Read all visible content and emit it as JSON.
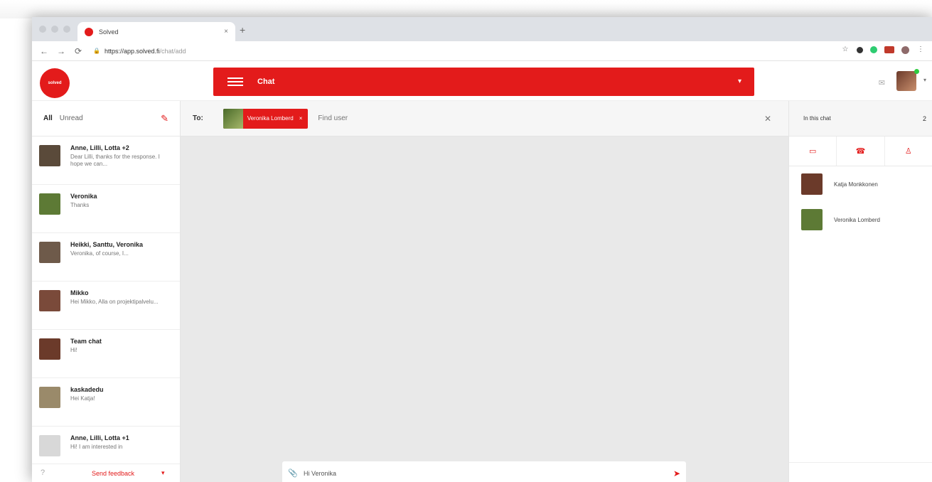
{
  "browser": {
    "tab_title": "Solved",
    "tab_close": "×",
    "new_tab": "+",
    "url_main": "https://app.solved.fi",
    "url_path": "/chat/add",
    "back": "←",
    "forward": "→",
    "reload": "⟳"
  },
  "header": {
    "logo_text": "solved",
    "section_title": "Chat",
    "section_caret": "▾",
    "user_caret": "▾"
  },
  "sidebar": {
    "filter_all": "All",
    "filter_unread": "Unread",
    "conversations": [
      {
        "name": "Anne, Lilli, Lotta +2",
        "message": "Dear Lilli, thanks for the response. I hope we can...",
        "avatar_color": "#5a4a3a"
      },
      {
        "name": "Veronika",
        "message": "Thanks",
        "avatar_color": "#5d7a35"
      },
      {
        "name": "Heikki, Santtu, Veronika",
        "message": "Veronika, of course, I...",
        "avatar_color": "#6e5a4a"
      },
      {
        "name": "Mikko",
        "message": "Hei Mikko, Alla on projektipalvelu...",
        "avatar_color": "#7a4a3a"
      },
      {
        "name": "Team chat",
        "message": "Hi!",
        "avatar_color": "#6b3a2a"
      },
      {
        "name": "kaskadedu",
        "message": "Hei Katja!",
        "avatar_color": "#9a8a6a"
      },
      {
        "name": "Anne, Lilli, Lotta +1",
        "message": "Hi! I am interested in",
        "avatar_color": "#d8d8d8"
      }
    ],
    "feedback": "Send feedback",
    "feedback_caret": "▾"
  },
  "center": {
    "to_label": "To:",
    "chip_name": "Veronika Lomberd",
    "chip_x": "×",
    "find_placeholder": "Find user",
    "composer_text": "Hi Veronika ",
    "composer_badge": "!"
  },
  "right_panel": {
    "title": "In this chat",
    "count": "2",
    "members": [
      {
        "name": "Katja Monkkonen",
        "avatar_color": "#6b3a2a"
      },
      {
        "name": "Veronika Lomberd",
        "avatar_color": "#5d7a35"
      }
    ]
  },
  "colors": {
    "accent": "#e31b1b"
  }
}
